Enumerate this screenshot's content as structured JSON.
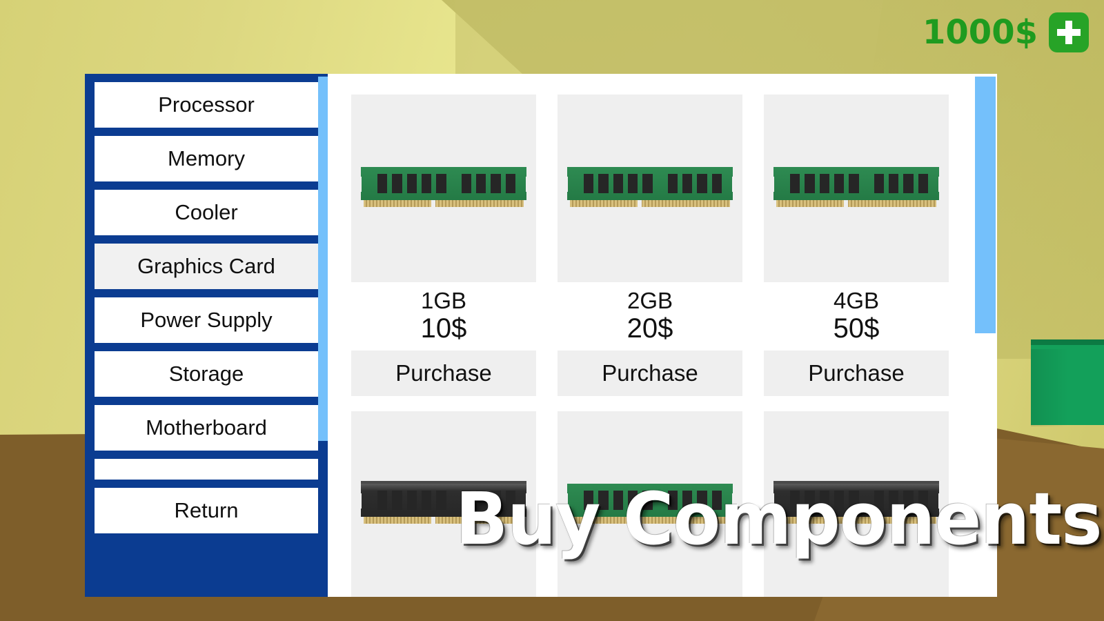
{
  "hud": {
    "money": "1000$",
    "add_button_icon": "plus-icon"
  },
  "overlay_title": "Buy Components",
  "sidebar": {
    "items": [
      {
        "label": "Processor",
        "selected": false
      },
      {
        "label": "Memory",
        "selected": false
      },
      {
        "label": "Cooler",
        "selected": false
      },
      {
        "label": "Graphics Card",
        "selected": true
      },
      {
        "label": "Power Supply",
        "selected": false
      },
      {
        "label": "Storage",
        "selected": false
      },
      {
        "label": "Motherboard",
        "selected": false
      },
      {
        "label": "",
        "selected": false
      },
      {
        "label": "Return",
        "selected": false
      }
    ]
  },
  "catalog": {
    "buy_label": "Purchase",
    "products": [
      {
        "name": "1GB",
        "price": "10$",
        "art": "ram-green"
      },
      {
        "name": "2GB",
        "price": "20$",
        "art": "ram-green"
      },
      {
        "name": "4GB",
        "price": "50$",
        "art": "ram-green"
      },
      {
        "name": "",
        "price": "",
        "art": "ram-black"
      },
      {
        "name": "",
        "price": "",
        "art": "ram-green"
      },
      {
        "name": "",
        "price": "",
        "art": "ram-black"
      }
    ]
  },
  "colors": {
    "menu_blue": "#0b3c91",
    "scrollbar_blue": "#74c0fb",
    "money_green": "#1f9b1f",
    "add_button_green": "#27a327",
    "card_gray": "#efefef",
    "wall": "#e9e78f",
    "floor": "#7e5e2a",
    "green_box": "#13a05a"
  }
}
